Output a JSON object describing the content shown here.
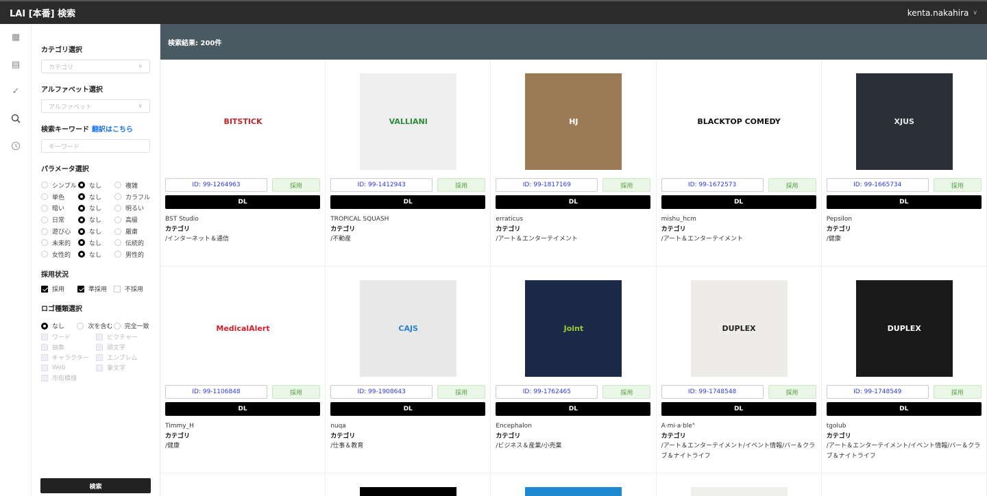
{
  "header": {
    "title": "LAI [本番] 検索",
    "user": "kenta.nakahira"
  },
  "rail": {
    "icons": [
      "grid-icon",
      "list-icon",
      "check-icon",
      "search-icon",
      "clock-icon"
    ]
  },
  "filters": {
    "category_label": "カテゴリ選択",
    "category_placeholder": "カテゴリ",
    "alphabet_label": "アルファベット選択",
    "alphabet_placeholder": "アルファベット",
    "keyword_label": "検索キーワード",
    "translate_link": "翻訳はこちら",
    "keyword_placeholder": "キーワード",
    "param_label": "パラメータ選択",
    "params": [
      {
        "left": "シンプル",
        "mid": "なし",
        "right": "複雑"
      },
      {
        "left": "単色",
        "mid": "なし",
        "right": "カラフル"
      },
      {
        "left": "暗い",
        "mid": "なし",
        "right": "明るい"
      },
      {
        "left": "日常",
        "mid": "なし",
        "right": "高級"
      },
      {
        "left": "遊び心",
        "mid": "なし",
        "right": "厳粛"
      },
      {
        "left": "未来的",
        "mid": "なし",
        "right": "伝統的"
      },
      {
        "left": "女性的",
        "mid": "なし",
        "right": "男性的"
      }
    ],
    "status_label": "採用状況",
    "status": [
      {
        "label": "採用",
        "checked": true
      },
      {
        "label": "準採用",
        "checked": true
      },
      {
        "label": "不採用",
        "checked": false
      }
    ],
    "logo_type_label": "ロゴ種類選択",
    "logo_modes": [
      {
        "label": "なし",
        "selected": true
      },
      {
        "label": "次を含む",
        "selected": false
      },
      {
        "label": "完全一致",
        "selected": false
      }
    ],
    "logo_types": [
      "ワード",
      "ピクチャー",
      "抽象",
      "頭文字",
      "キャラクター",
      "エンブレム",
      "Web",
      "筆文字",
      "市街模様"
    ],
    "search_button": "検索"
  },
  "results": {
    "summary": "検索結果: 200件",
    "category_heading": "カテゴリ",
    "adopt_label": "採用",
    "dl_label": "DL",
    "items": [
      {
        "id": "ID: 99-1264963",
        "name": "BST Studio",
        "category": "/インターネット＆通信",
        "logo": "BITSTICK",
        "bg": "#ffffff",
        "fg": "#c0262d"
      },
      {
        "id": "ID: 99-1412943",
        "name": "TROPICAL SQUASH",
        "category": "/不動産",
        "logo": "VALLIANI",
        "bg": "#eeeeee",
        "fg": "#2e8b3a"
      },
      {
        "id": "ID: 99-1817169",
        "name": "erraticus",
        "category": "/アート＆エンターテイメント",
        "logo": "HJ",
        "bg": "#9c7a55",
        "fg": "#ffffff"
      },
      {
        "id": "ID: 99-1672573",
        "name": "mishu_hcm",
        "category": "/アート＆エンターテイメント",
        "logo": "BLACKTOP COMEDY",
        "bg": "#ffffff",
        "fg": "#111111"
      },
      {
        "id": "ID: 99-1665734",
        "name": "Pepsilon",
        "category": "/健康",
        "logo": "XJUS",
        "bg": "#2a3038",
        "fg": "#e8e8e8"
      },
      {
        "id": "ID: 99-1106848",
        "name": "Timmy_H",
        "category": "/健康",
        "logo": "MedicalAlert",
        "bg": "#ffffff",
        "fg": "#d0202a"
      },
      {
        "id": "ID: 99-1908643",
        "name": "nuqa",
        "category": "/仕事＆教育",
        "logo": "CAJS",
        "bg": "#e8e8e8",
        "fg": "#2a7fd4"
      },
      {
        "id": "ID: 99-1762465",
        "name": "Encephalon",
        "category": "/ビジネス＆産業/小売業",
        "logo": "Joint",
        "bg": "#1c2a48",
        "fg": "#9acd32"
      },
      {
        "id": "ID: 99-1748548",
        "name": "A·mi·a·ble\"",
        "category": "/アート＆エンターテイメント/イベント情報/バー＆クラブ＆ナイトライフ",
        "logo": "DUPLEX",
        "bg": "#eeece8",
        "fg": "#222222"
      },
      {
        "id": "ID: 99-1748549",
        "name": "tgolub",
        "category": "/アート＆エンターテイメント/イベント情報/バー＆クラブ＆ナイトライフ",
        "logo": "DUPLEX",
        "bg": "#1a1a1a",
        "fg": "#ffffff"
      }
    ],
    "partial_row": [
      {
        "bg": "#ffffff"
      },
      {
        "bg": "#000000"
      },
      {
        "bg": "#1e88d0"
      },
      {
        "bg": "#eeeeea"
      },
      {
        "bg": "#ffffff"
      }
    ]
  }
}
